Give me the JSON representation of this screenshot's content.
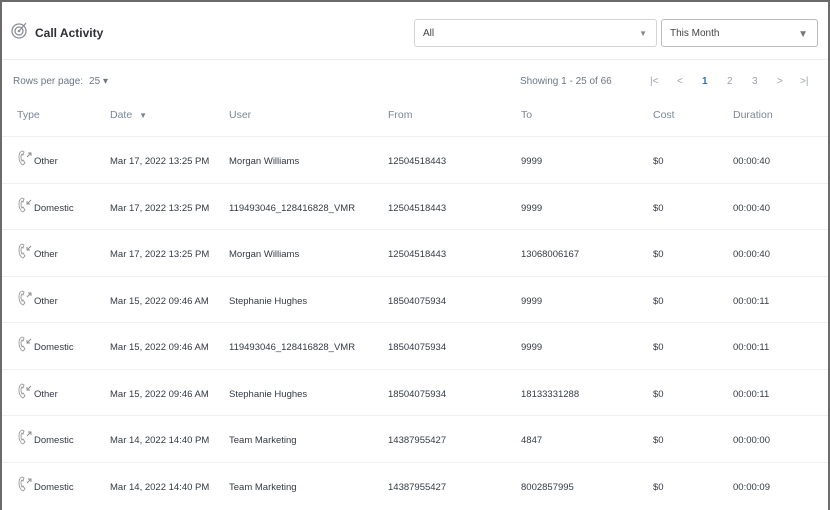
{
  "header": {
    "title": "Call Activity",
    "filter_type": "All",
    "filter_period": "This Month"
  },
  "toolbar": {
    "rows_per_page_label": "Rows per page:",
    "rows_per_page_value": "25",
    "showing": "Showing 1 - 25 of 66",
    "pages": [
      "1",
      "2",
      "3"
    ],
    "current_page": "1"
  },
  "columns": [
    "Type",
    "Date",
    "User",
    "From",
    "To",
    "Cost",
    "Duration"
  ],
  "sort_indicator": "▼",
  "rows": [
    {
      "dir": "out",
      "type": "Other",
      "date": "Mar 17, 2022 13:25 PM",
      "user": "Morgan Williams",
      "from": "12504518443",
      "to": "9999",
      "cost": "$0",
      "duration": "00:00:40"
    },
    {
      "dir": "in",
      "type": "Domestic",
      "date": "Mar 17, 2022 13:25 PM",
      "user": "119493046_128416828_VMR",
      "from": "12504518443",
      "to": "9999",
      "cost": "$0",
      "duration": "00:00:40"
    },
    {
      "dir": "in",
      "type": "Other",
      "date": "Mar 17, 2022 13:25 PM",
      "user": "Morgan Williams",
      "from": "12504518443",
      "to": "13068006167",
      "cost": "$0",
      "duration": "00:00:40"
    },
    {
      "dir": "out",
      "type": "Other",
      "date": "Mar 15, 2022 09:46 AM",
      "user": "Stephanie Hughes",
      "from": "18504075934",
      "to": "9999",
      "cost": "$0",
      "duration": "00:00:11"
    },
    {
      "dir": "in",
      "type": "Domestic",
      "date": "Mar 15, 2022 09:46 AM",
      "user": "119493046_128416828_VMR",
      "from": "18504075934",
      "to": "9999",
      "cost": "$0",
      "duration": "00:00:11"
    },
    {
      "dir": "in",
      "type": "Other",
      "date": "Mar 15, 2022 09:46 AM",
      "user": "Stephanie Hughes",
      "from": "18504075934",
      "to": "18133331288",
      "cost": "$0",
      "duration": "00:00:11"
    },
    {
      "dir": "out",
      "type": "Domestic",
      "date": "Mar 14, 2022 14:40 PM",
      "user": "Team Marketing",
      "from": "14387955427",
      "to": "4847",
      "cost": "$0",
      "duration": "00:00:00"
    },
    {
      "dir": "out",
      "type": "Domestic",
      "date": "Mar 14, 2022 14:40 PM",
      "user": "Team Marketing",
      "from": "14387955427",
      "to": "8002857995",
      "cost": "$0",
      "duration": "00:00:09"
    }
  ]
}
